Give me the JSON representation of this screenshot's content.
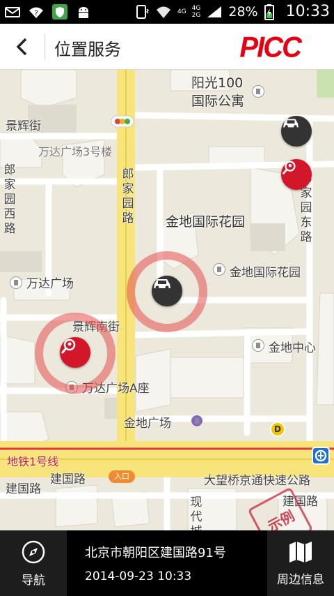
{
  "status_bar": {
    "icons_left": [
      "mail-icon",
      "wifi-unknown-icon",
      "shield-app-icon",
      "android-icon"
    ],
    "network_type": "4G",
    "sim_lines": [
      "4G",
      "2G"
    ],
    "battery_percent": "28%",
    "time": "10:33"
  },
  "header": {
    "title": "位置服务",
    "brand": "PICC",
    "brand_color": "#e60012"
  },
  "map": {
    "roads": {
      "jinghui_st": "景辉街",
      "langjiayuan_w": "郎家园西路",
      "langjiayuan": "郎家园路",
      "langjiayuan_e": "郎家园东路",
      "jinghui_south": "景辉南街",
      "jianguo_1": "建国路",
      "jianguo_2": "建国路",
      "jianguo_3": "建国路",
      "expressway": "大望桥京通快速公路",
      "subway_line1": "地铁1号线",
      "xiandai_city": "现代城"
    },
    "places": {
      "yangguang": "阳光100国际公寓",
      "yangguang_line1": "阳光100",
      "yangguang_line2": "国际公寓",
      "wanda_b3": "万达广场3号楼",
      "jindi_garden": "金地国际花园",
      "jindi_garden_poi": "金地国际花园",
      "wanda_plaza": "万达广场",
      "jindi_center": "金地中心",
      "wanda_a": "万达广场A座",
      "jindi_plaza": "金地广场"
    },
    "badges": {
      "entrance": "入口",
      "metro_d": "D"
    },
    "stamp": "示例",
    "colors": {
      "ring": "#e65050",
      "marker_dark": "#333333",
      "marker_red": "#d3172a"
    }
  },
  "bottom": {
    "nav_label": "导航",
    "address": "北京市朝阳区建国路91号",
    "timestamp": "2014-09-23 10:33",
    "nearby_label": "周边信息"
  }
}
